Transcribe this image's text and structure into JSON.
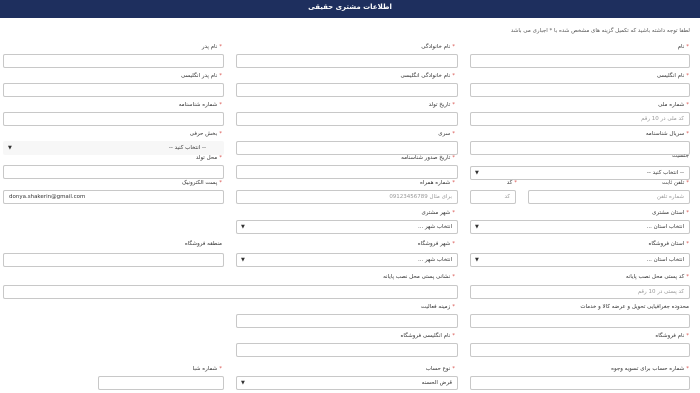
{
  "header": {
    "title": "اطلاعات مشتری حقیقی"
  },
  "note": "لطفا توجه داشته باشید که تکمیل گزینه های مشخص شده با * اجباری می باشد",
  "labels": {
    "name": "نام",
    "last_name": "نام خانوادگی",
    "father_name": "نام پدر",
    "name_en": "نام انگلیسی",
    "last_name_en": "نام خانوادگی انگلیسی",
    "father_name_en": "نام پدر انگلیسی",
    "national_code": "شماره ملی",
    "birth_date": "تاریخ تولد",
    "id_number": "شماره شناسنامه",
    "id_serial": "سریال شناسنامه",
    "series": "سری",
    "series_section": "بخش حرفی",
    "gender": "جنسیت",
    "id_issue_date": "تاریخ صدور شناسنامه",
    "birth_place": "محل تولد",
    "phone": "تلفن ثابت",
    "code": "کد",
    "mobile": "شماره همراه",
    "email": "پست الکترونیک",
    "customer_province": "استان مشتری",
    "customer_city": "شهر مشتری",
    "store_province": "استان فروشگاه",
    "store_city": "شهر فروشگاه",
    "store_region": "منطقه فروشگاه",
    "postal_code": "کد پستی محل نصب پایانه",
    "install_address": "نشانی پستی محل نصب پایانه",
    "geo_scope": "محدوده جغرافیایی تحویل و عرضه کالا و خدمات",
    "activity_field": "زمینه فعالیت",
    "store_name": "نام فروشگاه",
    "store_name_en": "نام انگلیسی فروشگاه",
    "settlement_account": "شماره حساب برای تسویه وجوه",
    "account_type": "نوع حساب",
    "sheba": "شماره شبا"
  },
  "placeholders": {
    "national_code": "کد ملی در 10 رقم",
    "phone": "شماره تلفن",
    "code": "کد",
    "mobile": "برای مثال 09123456789",
    "postal_code": "کد پستی در 10 رقم"
  },
  "values": {
    "email": "donya.shakerin@gmail.com",
    "series_section": "-- انتخاب کنید --",
    "gender": "-- انتخاب کنید --",
    "customer_province": "انتخاب استان ...",
    "customer_city": "انتخاب شهر ...",
    "store_province": "انتخاب استان ...",
    "store_city": "انتخاب شهر ...",
    "account_type": "قرض الحسنه"
  },
  "required_mark": "*",
  "dropdown_arrow": "▼"
}
